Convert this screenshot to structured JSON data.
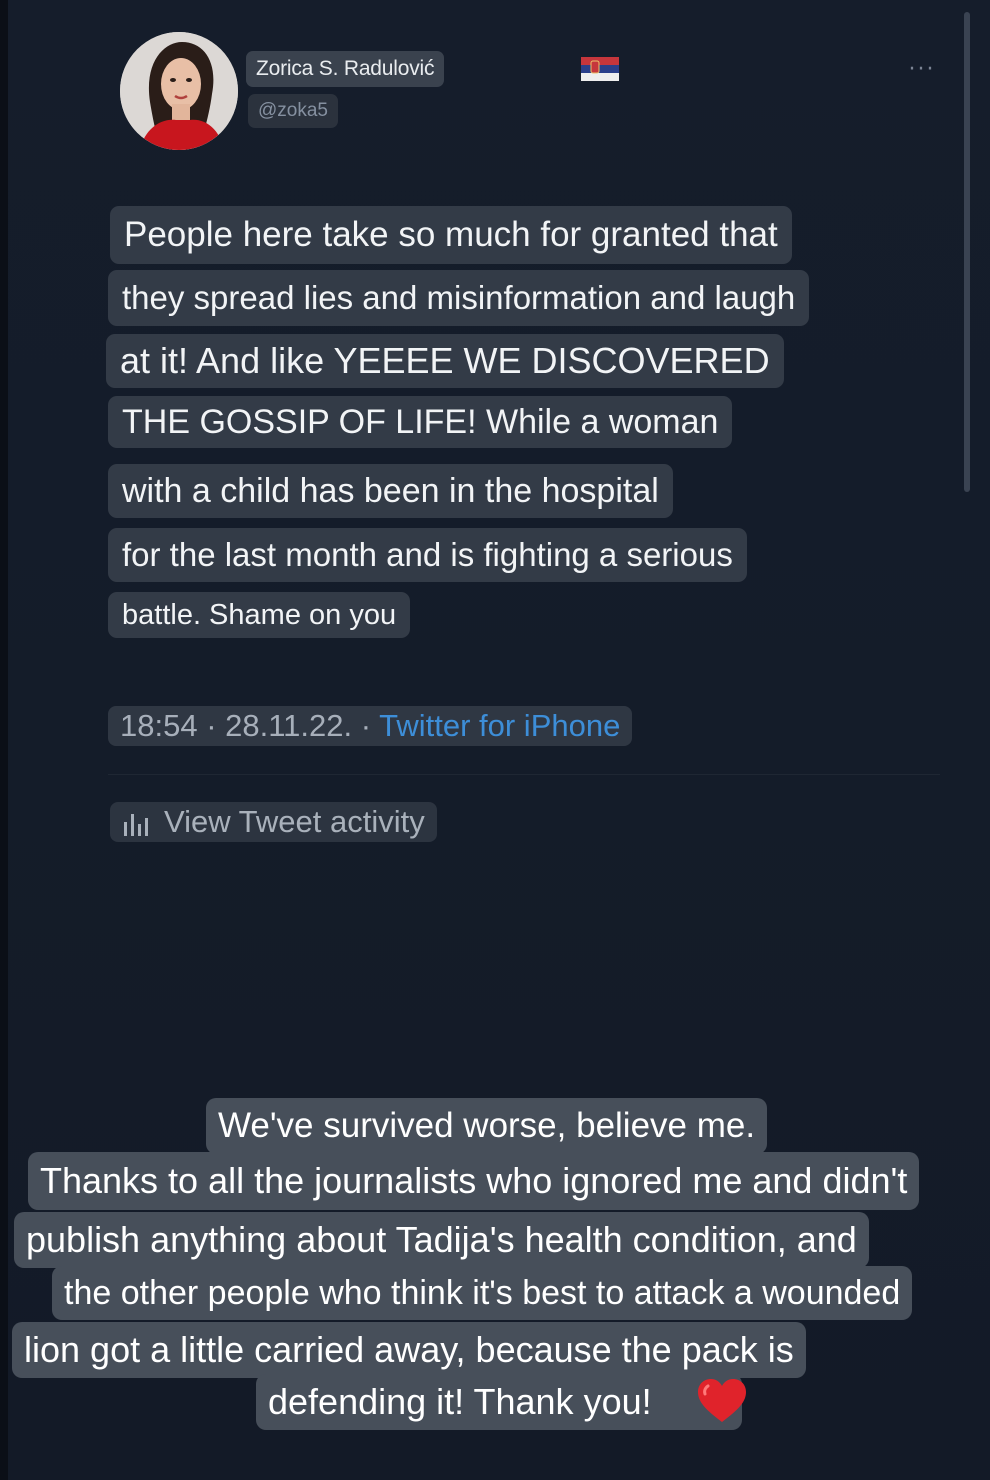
{
  "profile": {
    "display_name": "Zorica S. Radulović",
    "handle": "@zoka5",
    "avatar_icon": "profile-photo",
    "flag_icon": "serbia-flag-icon",
    "more_icon": "more-options-icon"
  },
  "tweet": {
    "lines": [
      "People here take so much for granted that",
      "they spread lies and misinformation and laugh",
      "at it! And like YEEEE WE DISCOVERED",
      "THE GOSSIP OF LIFE! While a woman",
      "with a child has been in the hospital",
      "for the last month and is fighting a serious",
      "battle. Shame on you"
    ],
    "timestamp": "18:54 · 28.11.22. ·",
    "source": "Twitter for iPhone",
    "activity_label": "View Tweet activity",
    "activity_icon": "bar-chart-icon"
  },
  "story_caption": {
    "lines": [
      "We've survived worse, believe me.",
      "Thanks to all the journalists who ignored me and didn't",
      "publish anything about Tadija's health condition, and",
      "the other people who think it's best to attack a wounded",
      "lion got a little carried away, because the pack is",
      "defending it! Thank you!"
    ],
    "emoji": "red-heart-icon"
  },
  "colors": {
    "background": "#141c2a",
    "link": "#3d8ed8",
    "heart": "#e0232b"
  }
}
